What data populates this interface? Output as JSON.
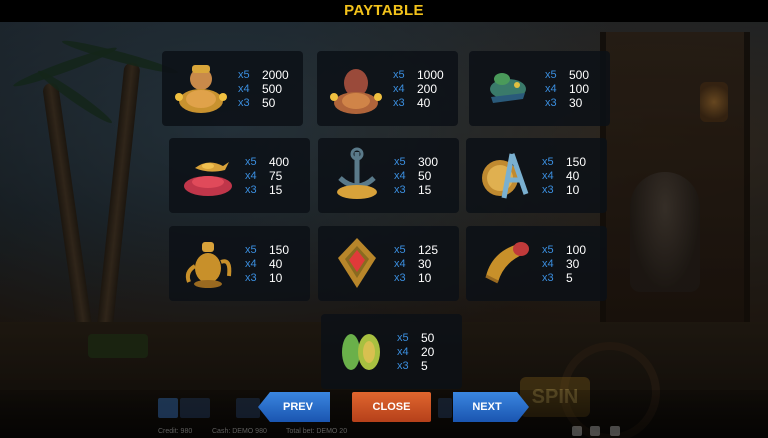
{
  "title": "PAYTABLE",
  "symbols": [
    {
      "name": "sultan",
      "pays": [
        {
          "mult": "x5",
          "val": "2000"
        },
        {
          "mult": "x4",
          "val": "500"
        },
        {
          "mult": "x3",
          "val": "50"
        }
      ]
    },
    {
      "name": "genie",
      "pays": [
        {
          "mult": "x5",
          "val": "1000"
        },
        {
          "mult": "x4",
          "val": "200"
        },
        {
          "mult": "x3",
          "val": "40"
        }
      ]
    },
    {
      "name": "parrot",
      "pays": [
        {
          "mult": "x5",
          "val": "500"
        },
        {
          "mult": "x4",
          "val": "100"
        },
        {
          "mult": "x3",
          "val": "30"
        }
      ]
    },
    {
      "name": "magic-lamp",
      "pays": [
        {
          "mult": "x5",
          "val": "400"
        },
        {
          "mult": "x4",
          "val": "75"
        },
        {
          "mult": "x3",
          "val": "15"
        }
      ]
    },
    {
      "name": "treasure-anchor",
      "pays": [
        {
          "mult": "x5",
          "val": "300"
        },
        {
          "mult": "x4",
          "val": "50"
        },
        {
          "mult": "x3",
          "val": "15"
        }
      ]
    },
    {
      "name": "golden-a",
      "pays": [
        {
          "mult": "x5",
          "val": "150"
        },
        {
          "mult": "x4",
          "val": "40"
        },
        {
          "mult": "x3",
          "val": "10"
        }
      ]
    },
    {
      "name": "teapot",
      "pays": [
        {
          "mult": "x5",
          "val": "150"
        },
        {
          "mult": "x4",
          "val": "40"
        },
        {
          "mult": "x3",
          "val": "10"
        }
      ]
    },
    {
      "name": "ruby-amulet",
      "pays": [
        {
          "mult": "x5",
          "val": "125"
        },
        {
          "mult": "x4",
          "val": "30"
        },
        {
          "mult": "x3",
          "val": "10"
        }
      ]
    },
    {
      "name": "horn",
      "pays": [
        {
          "mult": "x5",
          "val": "100"
        },
        {
          "mult": "x4",
          "val": "30"
        },
        {
          "mult": "x3",
          "val": "5"
        }
      ]
    },
    {
      "name": "green-fruit",
      "pays": [
        {
          "mult": "x5",
          "val": "50"
        },
        {
          "mult": "x4",
          "val": "20"
        },
        {
          "mult": "x3",
          "val": "5"
        }
      ]
    }
  ],
  "buttons": {
    "prev": "PREV",
    "close": "CLOSE",
    "next": "NEXT"
  },
  "background": {
    "spin": "SPIN",
    "status": {
      "credit": "Credit: 980",
      "cash": "Cash: DEMO 980",
      "total_bet": "Total bet: DEMO 20"
    }
  },
  "colors": {
    "title": "#f2c21b",
    "multiplier": "#3b8fe0",
    "value": "#ffffff",
    "nav": "#2a6fd0",
    "close": "#d4562a"
  }
}
